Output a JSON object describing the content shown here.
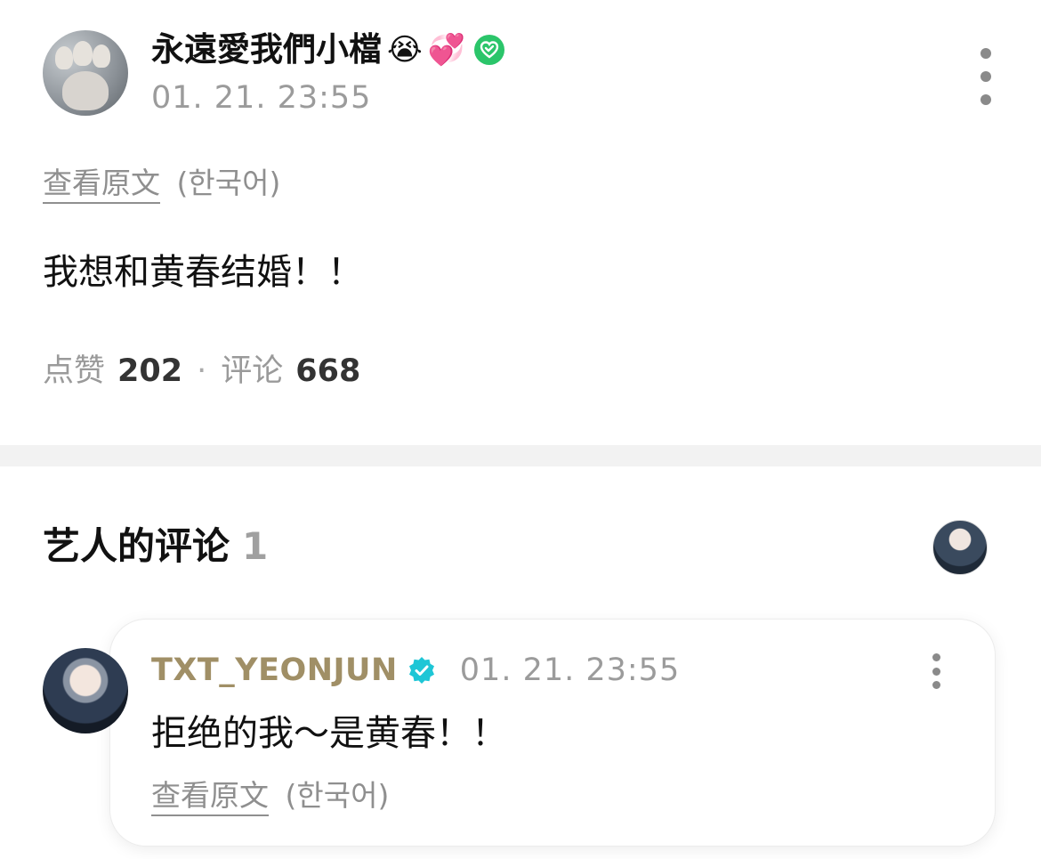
{
  "post": {
    "author_name": "永遠愛我們小檔",
    "author_emojis": [
      "😭",
      "💞"
    ],
    "timestamp": "01. 21. 23:55",
    "translate_link": "查看原文",
    "translate_lang": "(한국어)",
    "body": "我想和黄春结婚！！",
    "likes_label": "点赞",
    "likes_count": "202",
    "comments_label": "评论",
    "comments_count": "668",
    "stat_separator": "·"
  },
  "artist_comments": {
    "title": "艺人的评论",
    "count": "1",
    "comment": {
      "author": "TXT_YEONJUN",
      "timestamp": "01. 21. 23:55",
      "body": "拒绝的我～是黄春！！",
      "translate_link": "查看原文",
      "translate_lang": "(한국어)"
    }
  },
  "colors": {
    "artist_name": "#a08f66",
    "verified_green": "#2bc56a",
    "verified_cyan": "#1ec6d6",
    "muted_text": "#9b9b9b",
    "divider": "#f2f2f2"
  },
  "icons": {
    "post_verified": "heart-check-icon",
    "artist_verified": "verified-badge-icon",
    "post_menu": "more-vertical-icon",
    "comment_menu": "more-vertical-icon"
  }
}
